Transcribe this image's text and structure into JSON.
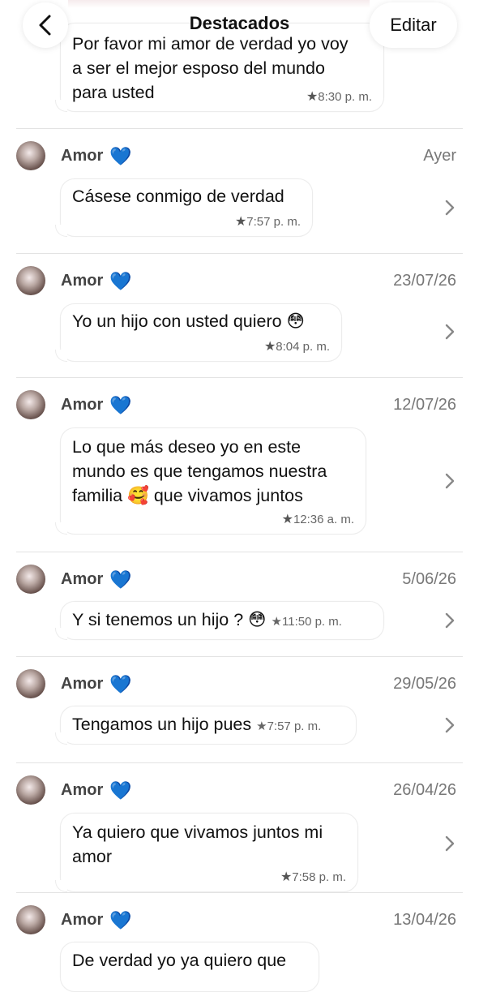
{
  "header": {
    "back_icon": "chevron-left-icon",
    "title": "Destacados",
    "edit_label": "Editar"
  },
  "top_message": {
    "text": "Por favor mi amor de verdad yo voy\na ser el mejor esposo del mundo\npara usted",
    "time": "8:30 p. m."
  },
  "items": [
    {
      "sender": "Amor",
      "emoji": "💙",
      "date": "Ayer",
      "text": "Cásese conmigo de verdad",
      "time": "7:57 p. m."
    },
    {
      "sender": "Amor",
      "emoji": "💙",
      "date": "23/07/26",
      "text": "Yo un hijo con usted quiero 😳",
      "time": "8:04 p. m."
    },
    {
      "sender": "Amor",
      "emoji": "💙",
      "date": "12/07/26",
      "text": "Lo que más deseo yo en este\nmundo es que tengamos nuestra\nfamilia 🥰 que vivamos juntos",
      "time": "12:36 a. m."
    },
    {
      "sender": "Amor",
      "emoji": "💙",
      "date": "5/06/26",
      "text": "Y si tenemos un hijo ? 😳",
      "time": "11:50 p. m."
    },
    {
      "sender": "Amor",
      "emoji": "💙",
      "date": "29/05/26",
      "text": "Tengamos un hijo pues",
      "time": "7:57 p. m."
    },
    {
      "sender": "Amor",
      "emoji": "💙",
      "date": "26/04/26",
      "text": "Ya quiero que vivamos juntos mi\namor",
      "time": "7:58 p. m."
    },
    {
      "sender": "Amor",
      "emoji": "💙",
      "date": "13/04/26",
      "text": "De verdad yo ya quiero que",
      "time": ""
    }
  ]
}
